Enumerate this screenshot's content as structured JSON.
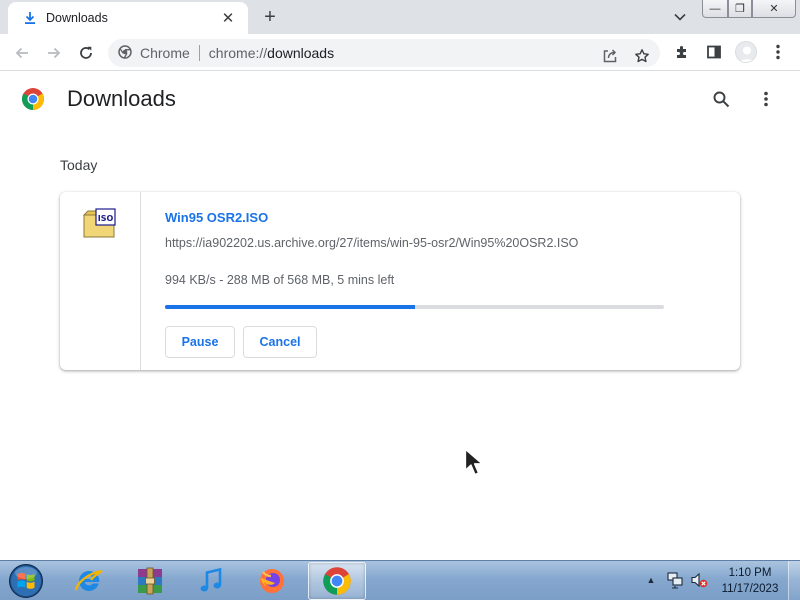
{
  "browser": {
    "tab": {
      "title": "Downloads",
      "close_glyph": "✕",
      "icon": "download-icon"
    },
    "new_tab_glyph": "+",
    "window_controls": {
      "minimize": "—",
      "maximize": "❐",
      "close": "✕"
    },
    "omnibox": {
      "chip_label": "Chrome",
      "url_scheme": "chrome://",
      "url_host": "downloads"
    }
  },
  "page": {
    "title": "Downloads",
    "date_heading": "Today",
    "download": {
      "file_name": "Win95 OSR2.ISO",
      "url": "https://ia902202.us.archive.org/27/items/win-95-osr2/Win95%20OSR2.ISO",
      "progress_text": "994 KB/s - 288 MB of 568 MB, 5 mins left",
      "progress_fraction": 0.5,
      "file_icon_label": "ISO",
      "pause_label": "Pause",
      "cancel_label": "Cancel"
    }
  },
  "taskbar": {
    "apps": [
      "internet-explorer",
      "winrar",
      "itunes",
      "firefox",
      "chrome"
    ],
    "active_app": "chrome",
    "tray_arrow": "▲",
    "clock_time": "1:10 PM",
    "clock_date": "11/17/2023"
  },
  "colors": {
    "accent": "#1a73e8",
    "tab_strip": "#dee1e6",
    "progress_track": "#dadce0"
  }
}
